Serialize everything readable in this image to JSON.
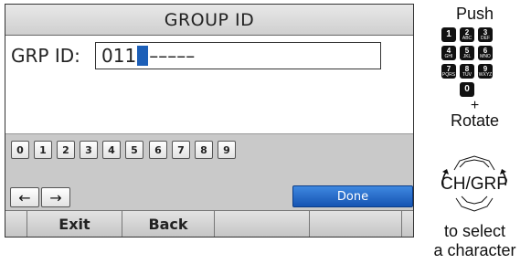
{
  "screen": {
    "title": "GROUP ID",
    "label": "GRP ID:",
    "value": "011",
    "blank_slots": "–––––",
    "digit_keys": [
      "0",
      "1",
      "2",
      "3",
      "4",
      "5",
      "6",
      "7",
      "8",
      "9"
    ],
    "arrows": {
      "left": "←",
      "right": "→"
    },
    "done_label": "Done",
    "softkeys": [
      "Exit",
      "Back",
      "",
      ""
    ]
  },
  "instructions": {
    "push": "Push",
    "keys": [
      {
        "num": "1",
        "letters": ""
      },
      {
        "num": "2",
        "letters": "ABC"
      },
      {
        "num": "3",
        "letters": "DEF"
      },
      {
        "num": "4",
        "letters": "GHI"
      },
      {
        "num": "5",
        "letters": "JKL"
      },
      {
        "num": "6",
        "letters": "MNO"
      },
      {
        "num": "7",
        "letters": "PQRS"
      },
      {
        "num": "8",
        "letters": "TUV"
      },
      {
        "num": "9",
        "letters": "WXYZ"
      },
      {
        "num": "0",
        "letters": ""
      }
    ],
    "plus": "+",
    "rotate": "Rotate",
    "dial_label": "CH/GRP",
    "to_select": "to select",
    "a_character": "a character"
  },
  "colors": {
    "accent": "#1c5fb8",
    "done_button": "#2a6fcf"
  }
}
